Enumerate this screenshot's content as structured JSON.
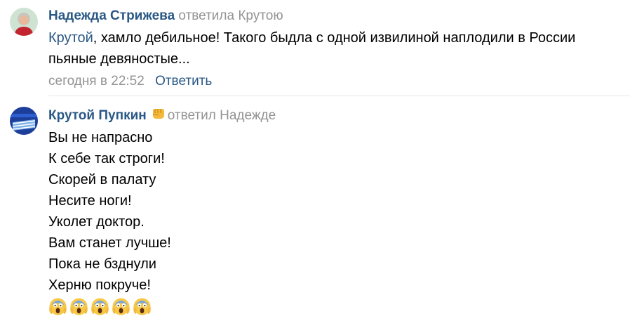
{
  "comments": [
    {
      "author": "Надежда Стрижева",
      "reply_to": "ответила Крутою",
      "mention": "Крутой",
      "text": ", хамло дебильное! Такого быдла с одной извилиной наплодили в России пьяные девяностые...",
      "date": "сегодня в 22:52",
      "reply_label": "Ответить"
    },
    {
      "author": "Крутой Пупкин",
      "reply_to": "ответил Надежде",
      "lines": [
        "Вы не напрасно",
        "К себе так строги!",
        "Скорей в палату",
        "Несите ноги!",
        "Уколет доктор.",
        "Вам станет лучше!",
        "Пока не бзднули",
        "Херню покруче!"
      ],
      "emoji_count": 5,
      "emoji_name": "face-screaming-in-fear-icon",
      "badge_name": "fist-icon"
    }
  ],
  "colors": {
    "link": "#2a5885",
    "muted": "#939393",
    "divider": "#e7e8ec"
  }
}
